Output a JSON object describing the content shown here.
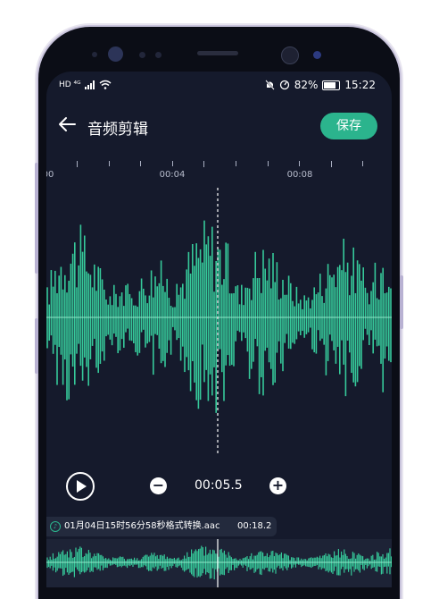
{
  "status_bar": {
    "left_indicators": "HD ⁴ᴳ",
    "battery_percent": "82%",
    "time": "15:22"
  },
  "header": {
    "title": "音频剪辑",
    "save_label": "保存"
  },
  "timeline": {
    "labels": [
      "00",
      "00:04",
      "00:08"
    ]
  },
  "controls": {
    "minus_label": "−",
    "current_time": "00:05.5",
    "plus_label": "+"
  },
  "file": {
    "name": "01月04日15时56分58秒格式转换.aac",
    "duration": "00:18.2"
  },
  "colors": {
    "background": "#151a2c",
    "accent": "#2bb48d",
    "waveform": "#36c99a"
  },
  "icons": {
    "back": "arrow-left-icon",
    "play": "play-circle-icon",
    "file": "music-note-icon",
    "signal": "signal-icon",
    "wifi": "wifi-icon",
    "mute": "mute-bell-icon",
    "rotate": "rotation-lock-icon",
    "battery": "battery-icon"
  }
}
